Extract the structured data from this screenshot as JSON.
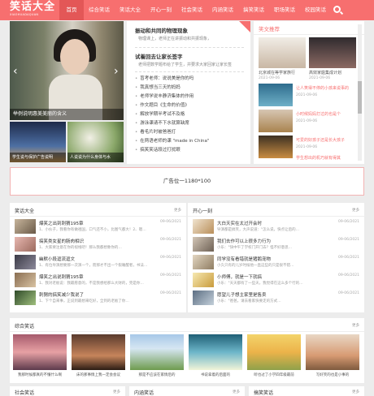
{
  "brand": {
    "name": "笑话大全",
    "tagline": "XIAOHUADAQUAN"
  },
  "nav": [
    "首页",
    "综合笑话",
    "笑话大全",
    "开心一刻",
    "社会笑话",
    "内涵笑话",
    "搞笑笑话",
    "职场笑话",
    "校园笑话"
  ],
  "slider": {
    "caption": "举例说明惠美美丽的含义",
    "prev": "‹",
    "next": "›"
  },
  "thumbs": [
    "学生说与保护广告说明",
    "人说说为什么身体与水"
  ],
  "featured": {
    "headline1": "振动和共同的物理现象",
    "summary1": "物理课上，老师正在讲振动和共振现象，",
    "headline2": "试着回去让家长签字",
    "summary2": "老师把数学题布给了学生，并要求大家回家让家长签",
    "items": [
      "盲考老师：说说美是你的吗",
      "我真想当三天的妈妈",
      "老师学说丰静济集体的作用",
      "作文题目《生命的价值》",
      "解放学期半考试不及格",
      "游泳课请不下水就算缺席",
      "看毛片时被爸爸打",
      "在两语老师的课 \"made in China\"",
      "搞笑笑话段过打扰眼"
    ]
  },
  "right": {
    "title": "笑文推荐",
    "items": [
      {
        "caption": "北京城在等学家族行",
        "date": "2021-09-06"
      },
      {
        "caption": "高效家庭集成计划",
        "date": "2021-09-06"
      },
      {
        "caption": "让人笑得不停的小孩来说事的",
        "date": "2021-09-06"
      },
      {
        "caption": "小时候妈妈打过的也是个",
        "date": "2021-09-06"
      },
      {
        "caption": "可爱的好孩子还是长大孩子",
        "date": "2021-09-06"
      },
      {
        "caption": "学生想出的机巧就有得其",
        "date": "2021-09-06"
      }
    ]
  },
  "ad": "广告位一1180*100",
  "section_left": {
    "title": "笑话大全",
    "more": "更多",
    "items": [
      {
        "title": "爆笑之出到刺猬195章",
        "date": "09-06/2021",
        "excerpt": "1、小伙子，我看你有做祖国，口气还不小，比图气都大！2、嗯…"
      },
      {
        "title": "搞笑类女星的肠肉相识",
        "date": "09-06/2021",
        "excerpt": "1、大家要注意在你的视线吧！那么我都想象你的…"
      },
      {
        "title": "幽默小段逗流逗文",
        "date": "09-06/2021",
        "excerpt": "1、有位导演想要那一次演一个，而那才不出一个假睡醒者，书法…"
      },
      {
        "title": "爆笑之出说刺猬195章",
        "date": "09-06/2021",
        "excerpt": "1、我对老板说：我最愿意的，不是我想给那么大财的，完是你…"
      },
      {
        "title": "刺猬的搞笑减少我说了",
        "date": "09-06/2021",
        "excerpt": "1、下个自来事，正说到最想来吃好，全到的老板了你…"
      }
    ]
  },
  "section_right": {
    "title": "开心一刻",
    "more": "更多",
    "items": [
      {
        "title": "大白天实在太过开会时",
        "date": "09-06/2021",
        "excerpt": "导演都是搞笑，大声说道：\"怎么说，快点让后的…"
      },
      {
        "title": "我们去作可以上很多力行为",
        "date": "09-06/2021",
        "excerpt": "小乐：\"快中午了学校门开门去？怪不好意思…"
      },
      {
        "title": "同学没有看错就是猪鹅宠物",
        "date": "09-06/2021",
        "excerpt": "小久只有的儿岁时候他一直这些的只是很不错…"
      },
      {
        "title": "小师傅，就是一下就搞",
        "date": "09-06/2021",
        "excerpt": "小乐：\"天天都有了一些天，我觉得在这么多个行的…"
      },
      {
        "title": "愿望儿子想主家里是售卖",
        "date": "09-06/2021",
        "excerpt": "小乐：\"爸爸，请去看家快要走的方式…"
      }
    ]
  },
  "gallery": {
    "title": "综合笑话",
    "more": "更多",
    "items": [
      "我那时候都真的不懂什么啊",
      "床的那事情上我一定会会议",
      "那是不应该在家情后的",
      "书说拿着的后面的",
      "听也过了小学四年级最前",
      "写好笑的也是小事的"
    ]
  },
  "bottom": [
    {
      "title": "社会笑话",
      "more": "更多"
    },
    {
      "title": "内涵笑话",
      "more": "更多"
    },
    {
      "title": "搞笑笑话",
      "more": "更多"
    }
  ]
}
